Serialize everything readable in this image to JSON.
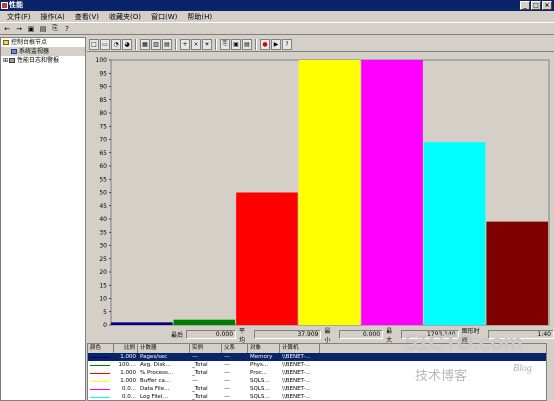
{
  "window": {
    "title": "性能",
    "colors": {
      "titlebar": "#0a246a"
    }
  },
  "menu": [
    "文件(F)",
    "操作(A)",
    "查看(V)",
    "收藏夹(O)",
    "窗口(W)",
    "帮助(H)"
  ],
  "tree": {
    "root": "控制台根节点",
    "items": [
      "系统监视器",
      "性能日志和警报"
    ]
  },
  "chart_data": {
    "type": "bar",
    "ylim": [
      0,
      100
    ],
    "yticks": [
      0,
      5,
      10,
      15,
      20,
      25,
      30,
      35,
      40,
      45,
      50,
      55,
      60,
      65,
      70,
      75,
      80,
      85,
      90,
      95,
      100
    ],
    "series": [
      {
        "value": 1,
        "color": "#000080"
      },
      {
        "value": 2,
        "color": "#008000"
      },
      {
        "value": 50,
        "color": "#ff0000"
      },
      {
        "value": 100,
        "color": "#ffff00"
      },
      {
        "value": 100,
        "color": "#ff00ff"
      },
      {
        "value": 69,
        "color": "#00ffff"
      },
      {
        "value": 39,
        "color": "#800000"
      }
    ]
  },
  "stats": {
    "last_label": "最后",
    "last": "0.000",
    "avg_label": "平均",
    "avg": "37.909",
    "min_label": "最小",
    "min": "0.000",
    "max_label": "最大",
    "max": "1793.140",
    "duration_label": "图形时间",
    "duration": "1:40"
  },
  "legend": {
    "headers": [
      "颜色",
      "比例",
      "计数器",
      "实例",
      "父系",
      "对象",
      "计算机"
    ],
    "rows": [
      {
        "color": "#000080",
        "scale": "1.000",
        "counter": "Pages/sec",
        "instance": "---",
        "parent": "---",
        "object": "Memory",
        "computer": "\\\\BENET-..."
      },
      {
        "color": "#008000",
        "scale": "100....",
        "counter": "Avg. Disk...",
        "instance": "_Total",
        "parent": "---",
        "object": "Phys...",
        "computer": "\\\\BENET-..."
      },
      {
        "color": "#ff0000",
        "scale": "1.000",
        "counter": "% Process...",
        "instance": "_Total",
        "parent": "---",
        "object": "Proc...",
        "computer": "\\\\BENET-..."
      },
      {
        "color": "#ffff00",
        "scale": "1.000",
        "counter": "Buffer ca...",
        "instance": "---",
        "parent": "---",
        "object": "SQLS...",
        "computer": "\\\\BENET-..."
      },
      {
        "color": "#ff00ff",
        "scale": "0.0...",
        "counter": "Data File...",
        "instance": "_Total",
        "parent": "---",
        "object": "SQLS...",
        "computer": "\\\\BENET-..."
      },
      {
        "color": "#00ffff",
        "scale": "0.0...",
        "counter": "Log File(...",
        "instance": "_Total",
        "parent": "---",
        "object": "SQLS...",
        "computer": "\\\\BENET-..."
      },
      {
        "color": "#800000",
        "scale": "0.0...",
        "counter": "Log File(...",
        "instance": "Tariff...",
        "parent": "---",
        "object": "SQLS...",
        "computer": "\\\\BENET-..."
      }
    ]
  },
  "watermark": {
    "line1": "51CTO.com",
    "line2": "技术博客",
    "line3": "Blog"
  }
}
